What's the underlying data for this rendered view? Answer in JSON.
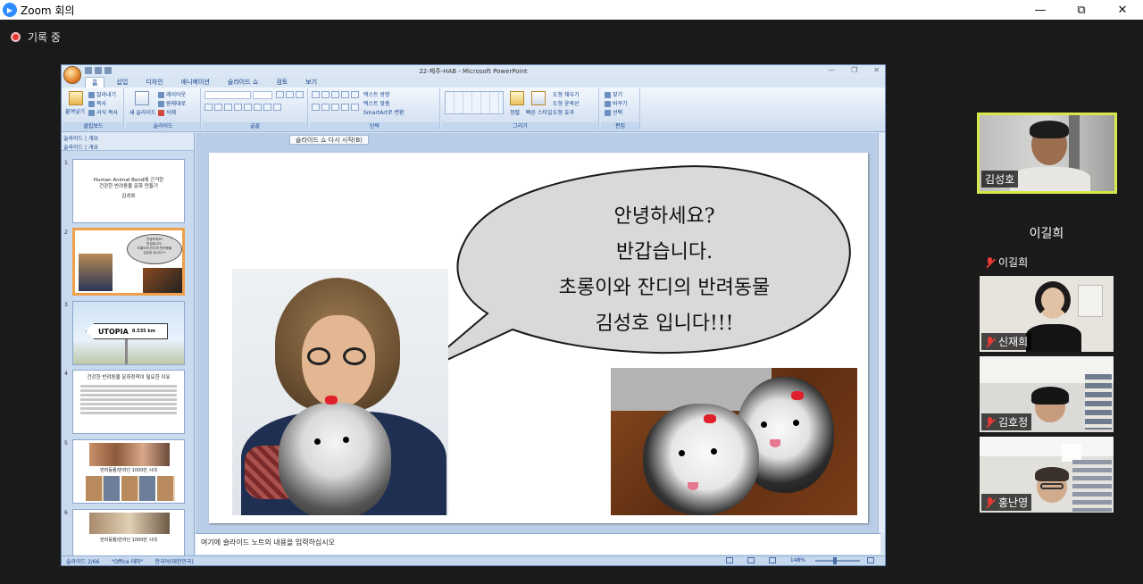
{
  "app": {
    "window_title": "Zoom 회의"
  },
  "window_controls": {
    "minimize": "—",
    "restore": "⧉",
    "close": "✕"
  },
  "recording": {
    "label": "기록 중"
  },
  "powerpoint": {
    "title": "22-제주-HAB - Microsoft PowerPoint",
    "tabs": [
      "홈",
      "삽입",
      "디자인",
      "애니메이션",
      "슬라이드 쇼",
      "검토",
      "보기"
    ],
    "ribbon": {
      "clipboard": {
        "label": "클립보드",
        "paste": "붙여넣기",
        "cut": "잘라내기",
        "copy": "복사",
        "format_painter": "서식 복사"
      },
      "slides": {
        "label": "슬라이드",
        "new_slide": "새 슬라이드",
        "layout": "레이아웃",
        "reset": "원래대로",
        "delete": "삭제"
      },
      "font": {
        "label": "글꼴"
      },
      "paragraph": {
        "label": "단락",
        "text_direction": "텍스트 방향",
        "align_text": "텍스트 맞춤",
        "smartart": "SmartArt로 변환"
      },
      "drawing": {
        "label": "그리기",
        "arrange": "정렬",
        "quick_styles": "빠른 스타일",
        "shape_fill": "도형 채우기",
        "shape_outline": "도형 윤곽선",
        "shape_effects": "도형 효과"
      },
      "editing": {
        "label": "편집",
        "find": "찾기",
        "replace": "바꾸기",
        "select": "선택"
      }
    },
    "panel_tabs": {
      "slides": "슬라이드",
      "outline": "개요"
    },
    "thumbnails": [
      {
        "num": "1",
        "lines": [
          "Human Animal Bond에 근거한",
          "건강한 반려동물 문화 만들기",
          "김성호"
        ]
      },
      {
        "num": "2",
        "lines": [
          "안녕하세요?",
          "반갑습니다.",
          "초롱이와 잔디의 반려동물",
          "김성호 입니다!!!"
        ]
      },
      {
        "num": "3",
        "sign": "UTOPIA",
        "distance": "8.535 km"
      },
      {
        "num": "4",
        "heading": "건강한 반려동물 문화정착이 필요한 이유"
      },
      {
        "num": "5",
        "caption": "반려동물/반려인 1000만 시대"
      },
      {
        "num": "6",
        "caption": "반려동물/반려인 1000만 시대"
      }
    ],
    "slideshow_tab": "슬라이드 쇼 다시 시작(B)",
    "slide": {
      "speech_lines": [
        "안녕하세요?",
        "반갑습니다.",
        "초롱이와 잔디의 반려동물",
        "김성호 입니다!!!"
      ]
    },
    "notes_placeholder": "여기에 슬라이드 노트의 내용을 입력하십시오",
    "status": {
      "slide_info": "슬라이드 2/66",
      "theme": "\"Office 테마\"",
      "language": "한국어(대한민국)",
      "zoom": "148%"
    }
  },
  "participants": [
    {
      "name": "김성호",
      "active": true,
      "video": true,
      "muted": false
    },
    {
      "name": "이길희",
      "active": false,
      "video": false,
      "muted": true
    },
    {
      "name": "신재희",
      "active": false,
      "video": true,
      "muted": true
    },
    {
      "name": "김호정",
      "active": false,
      "video": true,
      "muted": true
    },
    {
      "name": "홍난영",
      "active": false,
      "video": true,
      "muted": true
    }
  ],
  "colors": {
    "zoom_blue": "#2d8cff",
    "active_speaker": "#d6e84a",
    "record_red": "#e53935"
  }
}
